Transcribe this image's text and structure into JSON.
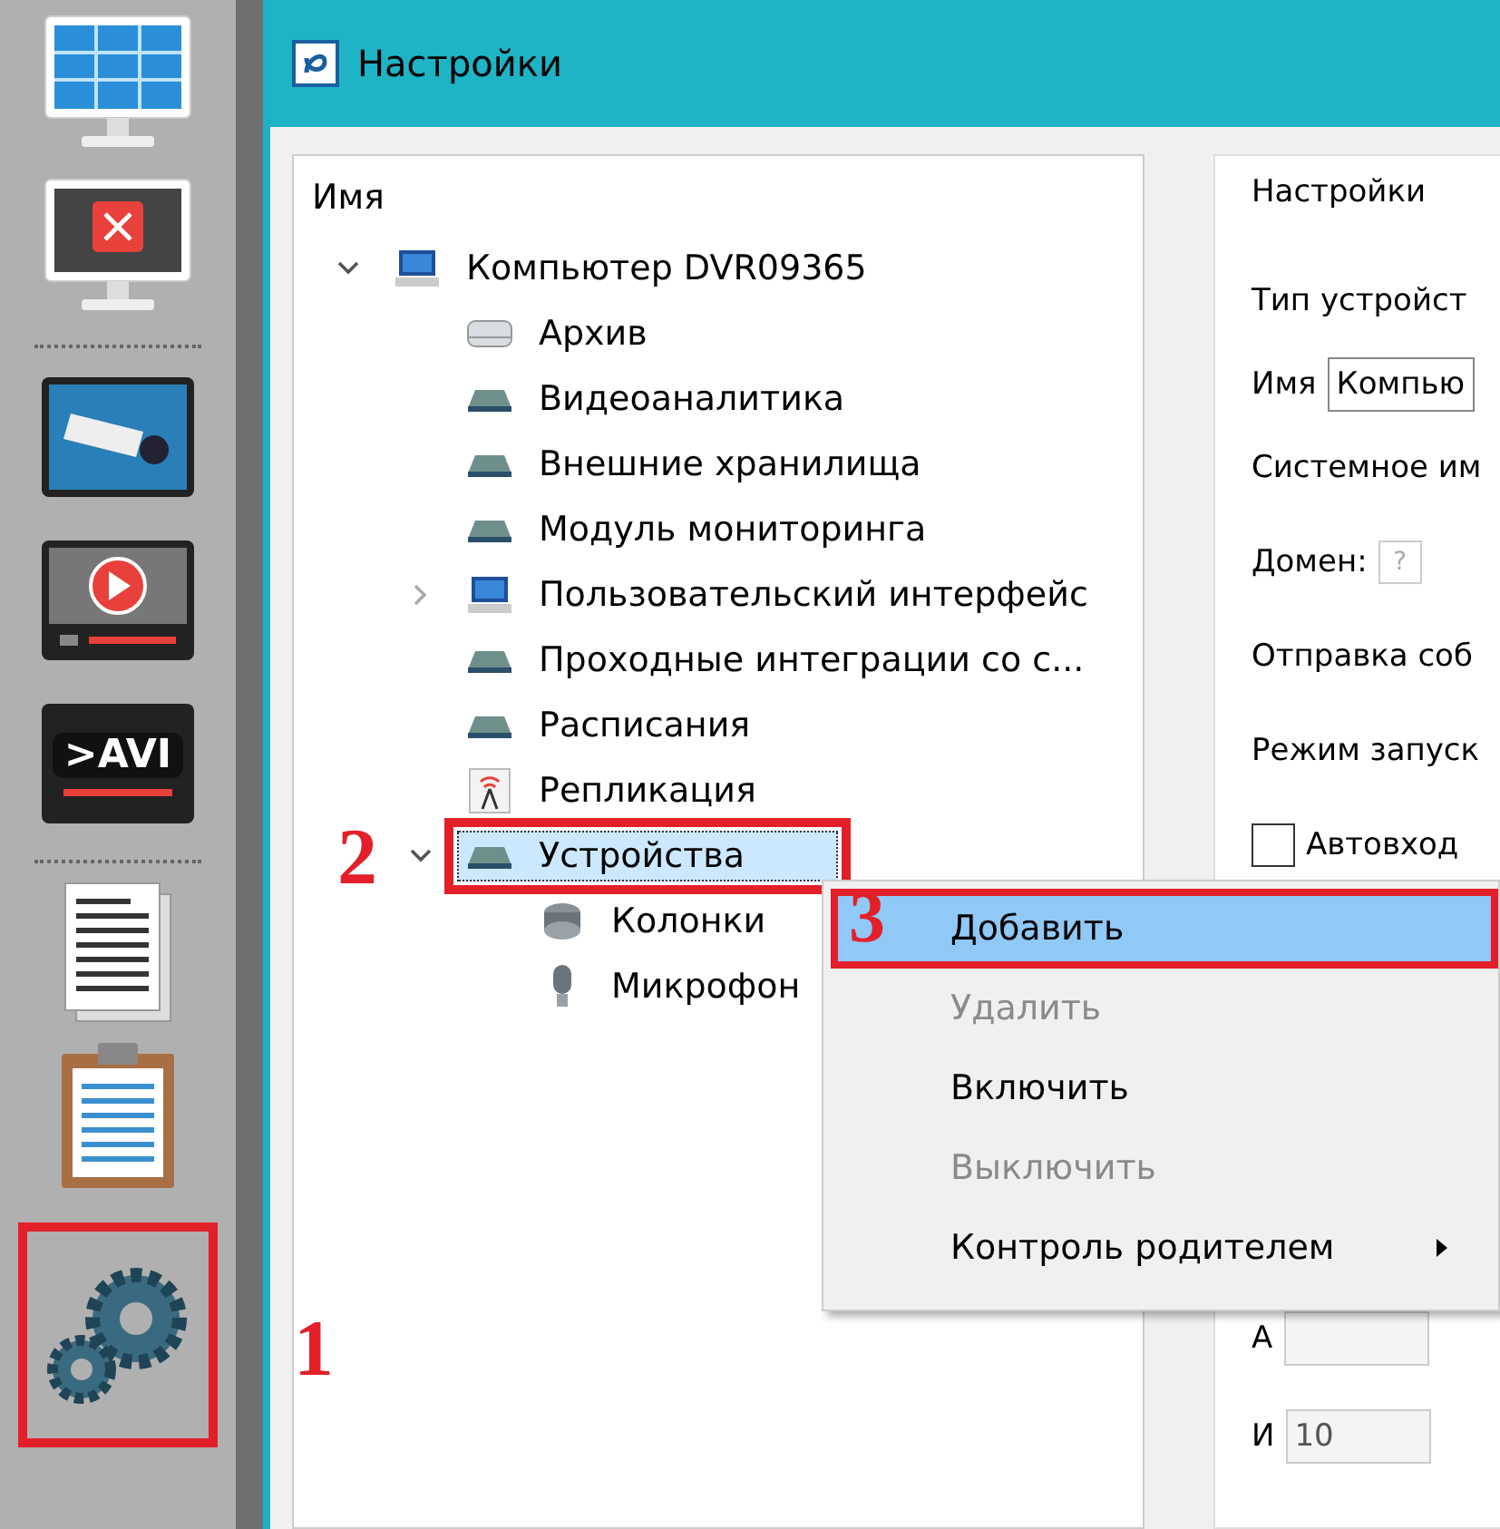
{
  "sidebar": {
    "items": [
      {
        "kind": "monitor-grid",
        "highlighted": false
      },
      {
        "kind": "monitor-x",
        "highlighted": false
      },
      {
        "kind": "separator"
      },
      {
        "kind": "camera",
        "highlighted": false
      },
      {
        "kind": "play",
        "highlighted": false
      },
      {
        "kind": "avi",
        "text": ">AVI",
        "highlighted": false
      },
      {
        "kind": "separator"
      },
      {
        "kind": "document",
        "highlighted": false
      },
      {
        "kind": "clipboard",
        "highlighted": false
      },
      {
        "kind": "gears",
        "highlighted": true,
        "callout": "1"
      }
    ]
  },
  "window": {
    "title": "Настройки"
  },
  "tree": {
    "header": "Имя",
    "items": [
      {
        "label": "Компьютер DVR09365",
        "kind": "computer",
        "expanded": true,
        "selected": false,
        "children": [
          {
            "label": "Архив",
            "kind": "drive",
            "selected": false
          },
          {
            "label": "Видеоаналитика",
            "kind": "module",
            "selected": false
          },
          {
            "label": "Внешние хранилища",
            "kind": "module",
            "selected": false
          },
          {
            "label": "Модуль мониторинга",
            "kind": "module",
            "selected": false
          },
          {
            "label": "Пользовательский интерфейс",
            "kind": "computer",
            "expanded": false,
            "selected": false
          },
          {
            "label": "Проходные интеграции со с...",
            "kind": "module",
            "selected": false
          },
          {
            "label": "Расписания",
            "kind": "module",
            "selected": false
          },
          {
            "label": "Репликация",
            "kind": "antenna",
            "selected": false
          },
          {
            "label": "Устройства",
            "kind": "module",
            "expanded": true,
            "selected": true,
            "highlighted": true,
            "callout": "2",
            "children": [
              {
                "label": "Колонки",
                "kind": "speaker",
                "selected": false
              },
              {
                "label": "Микрофон",
                "kind": "microphone",
                "selected": false
              }
            ]
          }
        ]
      }
    ]
  },
  "settings": {
    "title": "Настройки",
    "rows": [
      {
        "kind": "label",
        "text": "Тип устройст"
      },
      {
        "kind": "field",
        "label": "Имя",
        "value": "Компью"
      },
      {
        "kind": "label",
        "text": "Системное им"
      },
      {
        "kind": "help",
        "label": "Домен:",
        "text": "?"
      },
      {
        "kind": "label",
        "text": "Отправка соб"
      },
      {
        "kind": "label",
        "text": "Режим запуск"
      },
      {
        "kind": "checkbox",
        "text": "Автовход",
        "checked": false
      },
      {
        "kind": "field",
        "label": "А",
        "value": ""
      },
      {
        "kind": "field",
        "label": "И",
        "value": "10"
      }
    ]
  },
  "context_menu": {
    "items": [
      {
        "label": "Добавить",
        "selected": true,
        "disabled": false,
        "submenu": false,
        "highlighted": true,
        "callout": "3"
      },
      {
        "label": "Удалить",
        "selected": false,
        "disabled": true,
        "submenu": false,
        "highlighted": false
      },
      {
        "label": "Включить",
        "selected": false,
        "disabled": false,
        "submenu": false,
        "highlighted": false
      },
      {
        "label": "Выключить",
        "selected": false,
        "disabled": true,
        "submenu": false,
        "highlighted": false
      },
      {
        "label": "Контроль родителем",
        "selected": false,
        "disabled": false,
        "submenu": true,
        "highlighted": false
      }
    ]
  }
}
